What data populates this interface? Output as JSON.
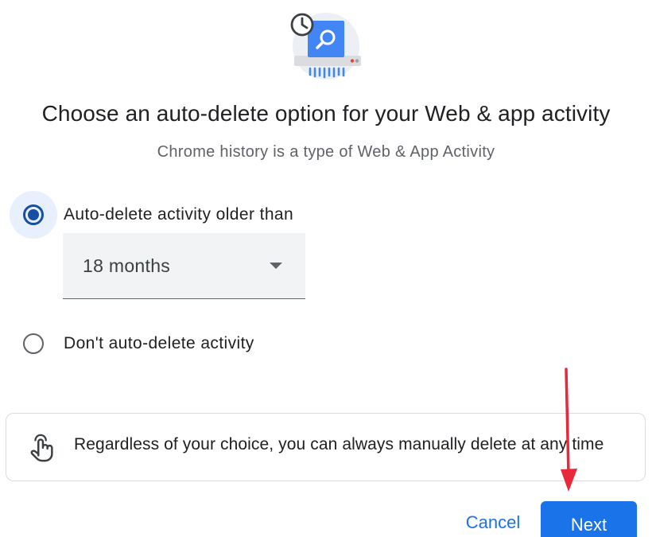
{
  "header": {
    "illustration_icon": "auto-delete-illustration-icon",
    "title": "Choose an auto-delete option for your Web & app activity",
    "subtitle": "Chrome history is a type of Web & App Activity"
  },
  "options": [
    {
      "label": "Auto-delete activity older than",
      "selected": true
    },
    {
      "label": "Don't auto-delete activity",
      "selected": false
    }
  ],
  "retention_select": {
    "value": "18 months",
    "icon": "dropdown-caret-icon"
  },
  "info_card": {
    "icon": "touch-hand-icon",
    "text": "Regardless of your choice, you can always manually delete at any time"
  },
  "actions": {
    "cancel_label": "Cancel",
    "next_label": "Next"
  },
  "colors": {
    "accent": "#1a73e8",
    "radio_selected": "#174ea6",
    "annotation_arrow": "#e8283b"
  }
}
